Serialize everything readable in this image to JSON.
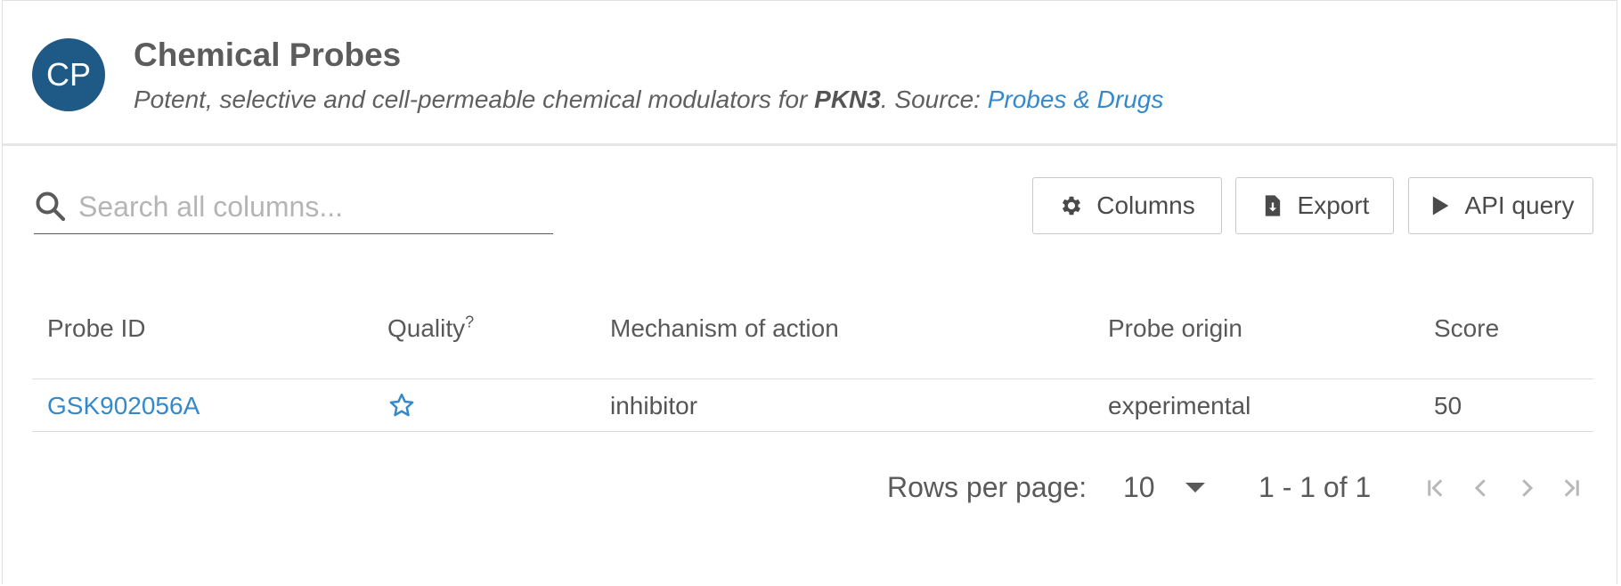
{
  "header": {
    "avatar_initials": "CP",
    "title": "Chemical Probes",
    "subtitle_prefix": "Potent, selective and cell-permeable chemical modulators for ",
    "subtitle_target": "PKN3",
    "subtitle_mid": ". Source: ",
    "subtitle_link": "Probes & Drugs"
  },
  "search": {
    "placeholder": "Search all columns...",
    "value": ""
  },
  "toolbar": {
    "columns_label": "Columns",
    "export_label": "Export",
    "api_label": "API query"
  },
  "table": {
    "columns": [
      "Probe ID",
      "Quality",
      "Mechanism of action",
      "Probe origin",
      "Score"
    ],
    "quality_help": "?",
    "rows": [
      {
        "probe_id": "GSK902056A",
        "quality": "star-outline-icon",
        "mechanism": "inhibitor",
        "origin": "experimental",
        "score": "50"
      }
    ]
  },
  "pagination": {
    "rows_per_page_label": "Rows per page:",
    "rows_per_page_value": "10",
    "range_text": "1 - 1 of 1"
  },
  "colors": {
    "accent": "#3489ca",
    "avatar_bg": "#1f5a86",
    "text": "#5a5a5a"
  }
}
